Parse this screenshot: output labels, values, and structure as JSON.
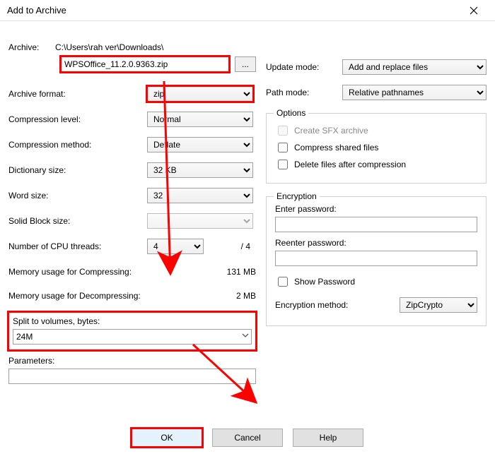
{
  "window": {
    "title": "Add to Archive"
  },
  "archive": {
    "label": "Archive:",
    "path": "C:\\Users\\rah ver\\Downloads\\",
    "filename": "WPSOffice_11.2.0.9363.zip",
    "browse": "..."
  },
  "left": {
    "format_label": "Archive format:",
    "format_value": "zip",
    "level_label": "Compression level:",
    "level_value": "Normal",
    "method_label": "Compression method:",
    "method_value": "Deflate",
    "dict_label": "Dictionary size:",
    "dict_value": "32 KB",
    "word_label": "Word size:",
    "word_value": "32",
    "solid_label": "Solid Block size:",
    "solid_value": "",
    "cpu_label": "Number of CPU threads:",
    "cpu_value": "4",
    "cpu_max": "/ 4",
    "mem_comp_label": "Memory usage for Compressing:",
    "mem_comp_value": "131 MB",
    "mem_decomp_label": "Memory usage for Decompressing:",
    "mem_decomp_value": "2 MB",
    "split_label": "Split to volumes, bytes:",
    "split_value": "24M",
    "params_label": "Parameters:",
    "params_value": ""
  },
  "right": {
    "update_label": "Update mode:",
    "update_value": "Add and replace files",
    "path_label": "Path mode:",
    "path_value": "Relative pathnames",
    "options_legend": "Options",
    "sfx_label": "Create SFX archive",
    "shared_label": "Compress shared files",
    "delete_label": "Delete files after compression",
    "enc_legend": "Encryption",
    "pw_label": "Enter password:",
    "repw_label": "Reenter password:",
    "showpw_label": "Show Password",
    "encmethod_label": "Encryption method:",
    "encmethod_value": "ZipCrypto"
  },
  "buttons": {
    "ok": "OK",
    "cancel": "Cancel",
    "help": "Help"
  }
}
